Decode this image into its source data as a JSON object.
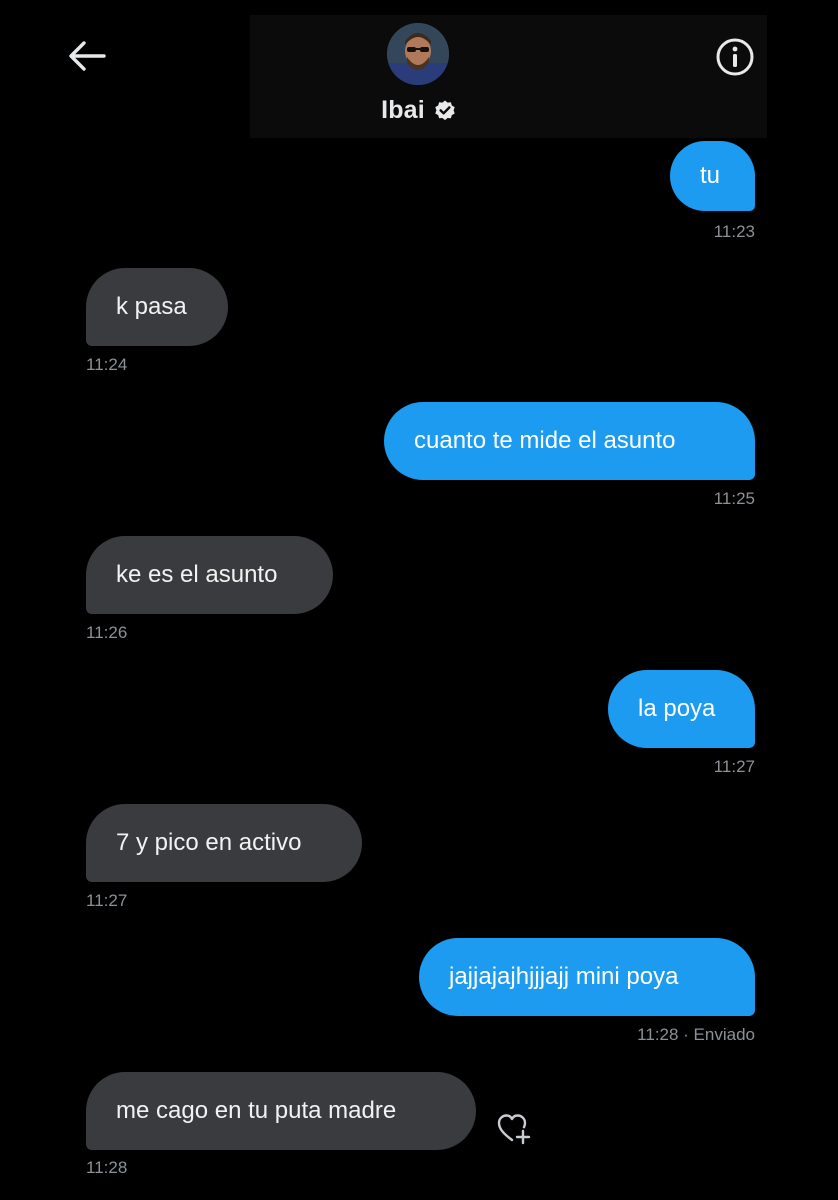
{
  "header": {
    "contact_name": "Ibai"
  },
  "messages": [
    {
      "side": "out",
      "text": "tu",
      "time": "11:23"
    },
    {
      "side": "in",
      "text": "k pasa",
      "time": "11:24"
    },
    {
      "side": "out",
      "text": "cuanto te mide el asunto",
      "time": "11:25"
    },
    {
      "side": "in",
      "text": "ke es el asunto",
      "time": "11:26"
    },
    {
      "side": "out",
      "text": "la poya",
      "time": "11:27"
    },
    {
      "side": "in",
      "text": "7 y pico en activo",
      "time": "11:27"
    },
    {
      "side": "out",
      "text": "jajjajajhjjjajj mini poya",
      "time": "11:28 · Enviado"
    },
    {
      "side": "in",
      "text": "me cago en tu puta madre",
      "time": "11:28"
    }
  ],
  "colors": {
    "background": "#000000",
    "incoming_bubble": "#3a3b3f",
    "outgoing_bubble": "#1d9bf0",
    "timestamp": "#8b9197"
  },
  "icons": {
    "back": "back-arrow-icon",
    "info": "info-icon",
    "verified": "verified-badge-icon",
    "reaction": "add-reaction-heart-icon"
  }
}
